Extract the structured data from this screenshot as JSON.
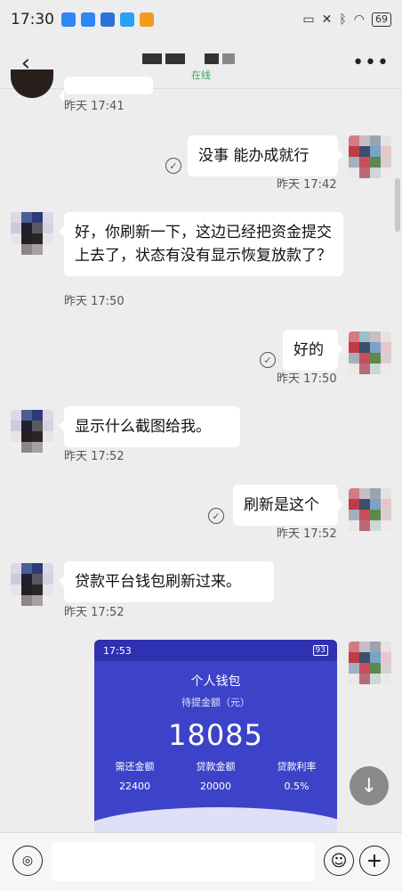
{
  "status_bar": {
    "time": "17:30",
    "battery": "69"
  },
  "header": {
    "status": "在线"
  },
  "messages": [
    {
      "side": "left",
      "text": "",
      "time": "昨天 17:41"
    },
    {
      "side": "right",
      "text": "没事  能办成就行",
      "time": "昨天 17:42"
    },
    {
      "side": "left",
      "text": "好，你刷新一下，这边已经把资金提交上去了，状态有没有显示恢复放款了？",
      "time": "昨天 17:50"
    },
    {
      "side": "right",
      "text": "好的",
      "time": "昨天 17:50"
    },
    {
      "side": "left",
      "text": "显示什么截图给我。",
      "time": "昨天 17:52"
    },
    {
      "side": "right",
      "text": "刷新是这个",
      "time": "昨天 17:52"
    },
    {
      "side": "left",
      "text": "贷款平台钱包刷新过来。",
      "time": "昨天 17:52"
    }
  ],
  "image_message": {
    "status_time": "17:53",
    "battery": "93",
    "title": "个人钱包",
    "subtitle": "待提金额（元）",
    "amount": "18085",
    "labels": [
      "需还金额",
      "贷款金额",
      "贷款利率"
    ],
    "values": [
      "22400",
      "20000",
      "0.5%"
    ]
  },
  "input": {
    "placeholder": ""
  },
  "icons": {
    "back": "back-arrow-icon",
    "more": "more-icon",
    "voice": "voice-icon",
    "emoji": "emoji-icon",
    "plus": "plus-icon",
    "scroll": "arrow-down-icon"
  }
}
